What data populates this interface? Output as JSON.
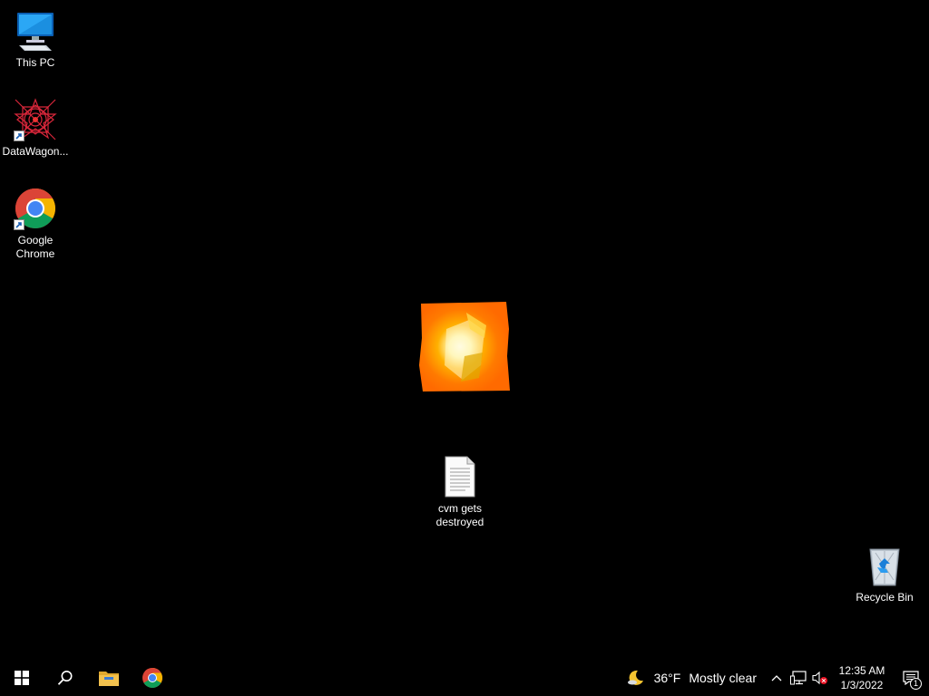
{
  "desktop": {
    "icons": [
      {
        "label": "This PC"
      },
      {
        "label": "DataWagon..."
      },
      {
        "label": "Google Chrome"
      },
      {
        "label": "cvm gets destroyed"
      },
      {
        "label": "Recycle Bin"
      }
    ]
  },
  "taskbar": {
    "weather": {
      "temp": "36°F",
      "condition": "Mostly clear"
    },
    "clock": {
      "time": "12:35 AM",
      "date": "1/3/2022"
    },
    "notifications": {
      "count": "1"
    }
  },
  "colors": {
    "accent": "#1a8cff",
    "chrome_red": "#db4437",
    "chrome_yellow": "#f4b400",
    "chrome_green": "#0f9d58",
    "chrome_blue": "#4285f4",
    "fire_orange": "#ff7a00",
    "folder_yellow": "#f2c14e"
  }
}
